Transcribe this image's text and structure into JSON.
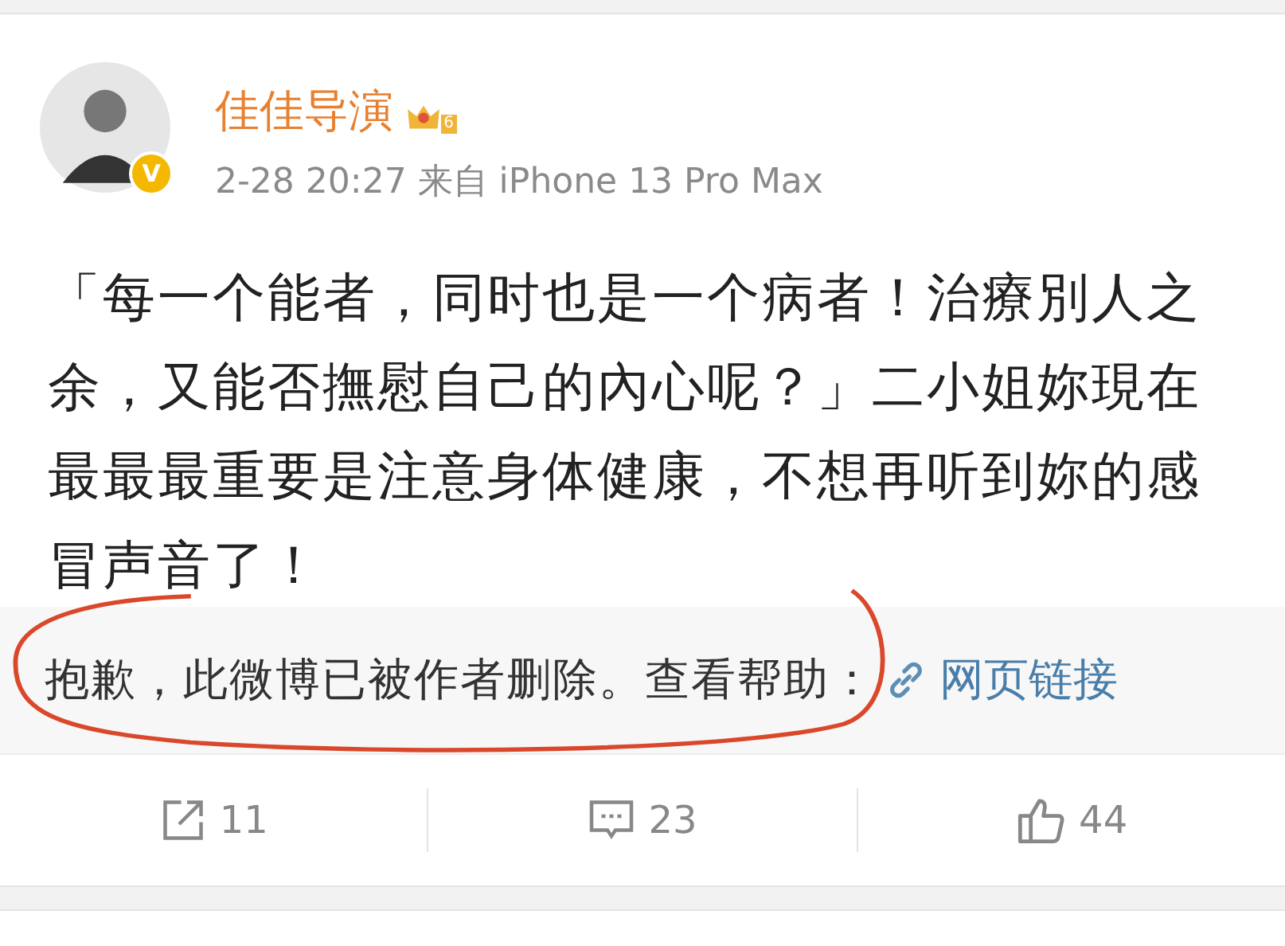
{
  "post": {
    "author": "佳佳导演",
    "level_badge": "6",
    "verified_mark": "V",
    "meta": "2-28 20:27 来自 iPhone 13 Pro Max",
    "body": "「每一个能者，同时也是一个病者！治療別人之余，又能否撫慰自己的內心呢？」二小姐妳現在最最最重要是注意身体健康，不想再听到妳的感冒声音了！",
    "retweet": {
      "notice": "抱歉，此微博已被作者删除。查看帮助：",
      "link": "网页链接"
    },
    "actions": [
      {
        "kind": "repost",
        "count": "11"
      },
      {
        "kind": "comment",
        "count": "23"
      },
      {
        "kind": "like",
        "count": "44"
      }
    ]
  }
}
